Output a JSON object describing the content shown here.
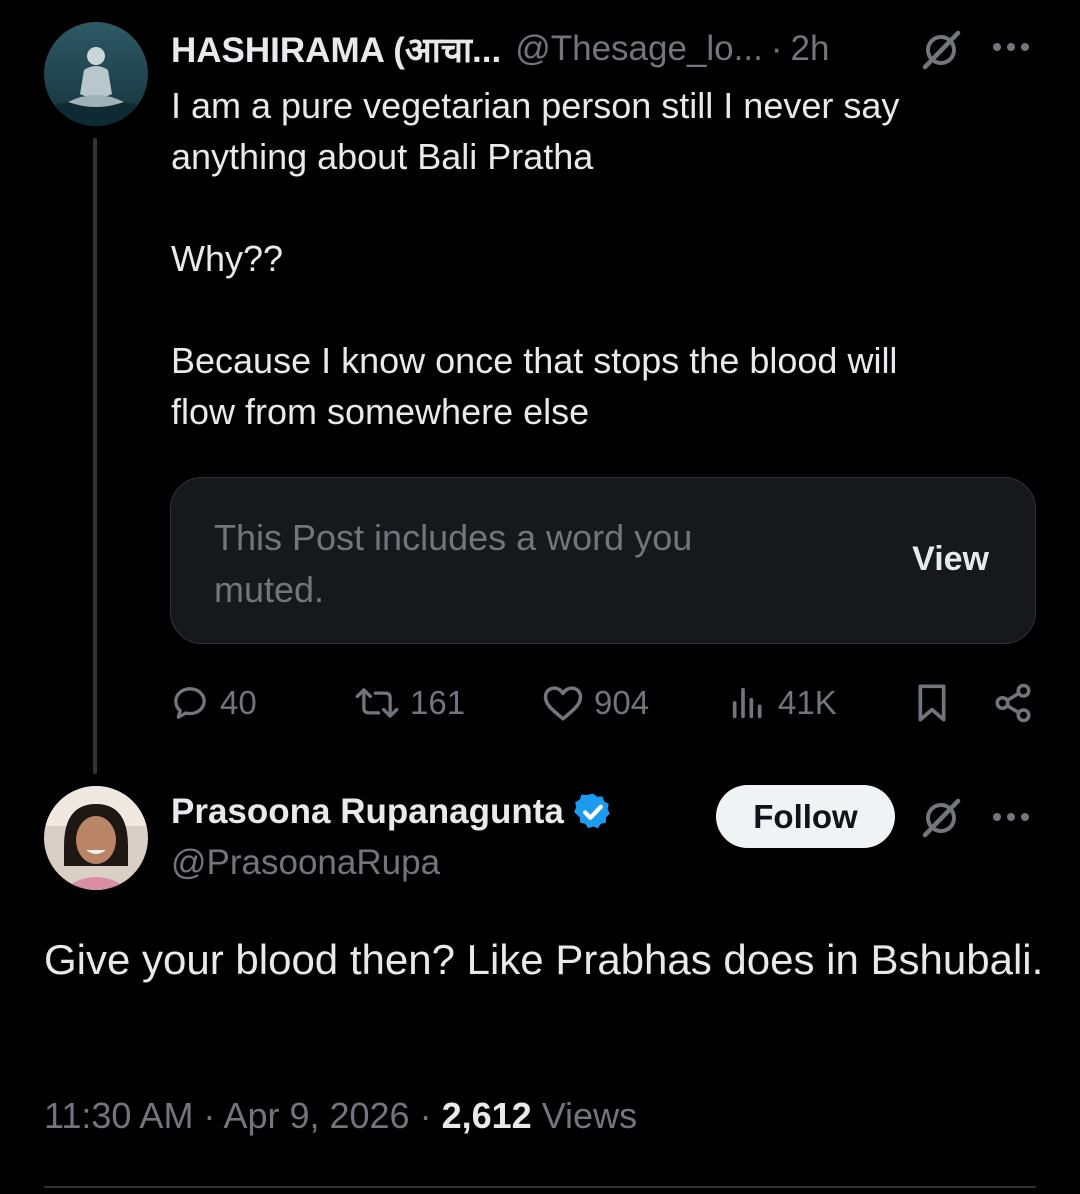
{
  "parent_post": {
    "author_name": "HASHIRAMA (आचा...",
    "handle": "@Thesage_lo...",
    "separator": "·",
    "time": "2h",
    "text_lines": [
      "I am a pure vegetarian person still I never say",
      "anything about Bali Pratha",
      "",
      "Why??",
      "",
      "Because I know once that stops the blood will",
      "flow from somewhere else"
    ],
    "muted_notice": {
      "message": "This Post includes a word you muted.",
      "action_label": "View"
    },
    "stats": {
      "replies": "40",
      "reposts": "161",
      "likes": "904",
      "views": "41K"
    }
  },
  "reply_post": {
    "author_name": "Prasoona Rupanagunta",
    "verified": true,
    "handle": "@PrasoonaRupa",
    "follow_label": "Follow",
    "text": "Give your blood then? Like Prabhas does in Bshubali.",
    "timestamp": "11:30 AM · Apr 9, 2026 ·",
    "view_count": "2,612",
    "views_label": "Views"
  },
  "colors": {
    "background": "#000000",
    "primary_text": "#e7e9ea",
    "secondary_text": "#71767b",
    "verified_blue": "#1d9bf0",
    "follow_button_bg": "#eff3f4"
  }
}
